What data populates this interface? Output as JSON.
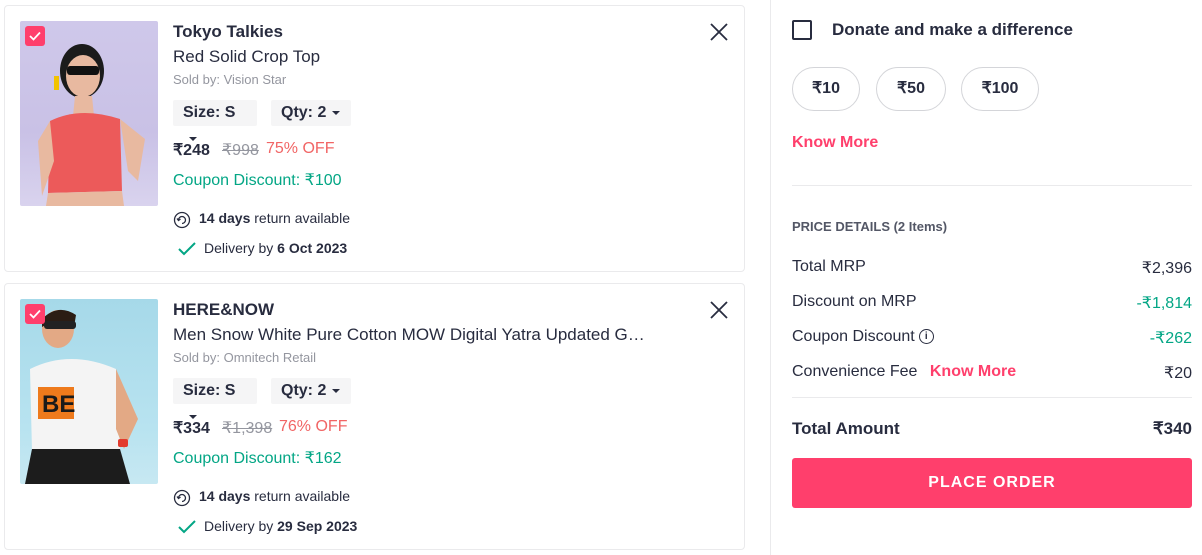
{
  "cart_items": [
    {
      "brand": "Tokyo Talkies",
      "name": "Red Solid Crop Top",
      "seller": "Sold by: Vision Star",
      "size_label": "Size: S",
      "qty_label": "Qty: 2",
      "price": "₹248",
      "mrp": "₹998",
      "discount": "75% OFF",
      "coupon": "Coupon Discount: ₹100",
      "return_days": "14 days",
      "return_text": " return available",
      "delivery_prefix": "Delivery by ",
      "delivery_date": "6 Oct 2023",
      "selected": true
    },
    {
      "brand": "HERE&NOW",
      "name": "Men Snow White Pure Cotton MOW Digital Yatra Updated G…",
      "seller": "Sold by: Omnitech Retail",
      "size_label": "Size: S",
      "qty_label": "Qty: 2",
      "price": "₹334",
      "mrp": "₹1,398",
      "discount": "76% OFF",
      "coupon": "Coupon Discount: ₹162",
      "return_days": "14 days",
      "return_text": " return available",
      "delivery_prefix": "Delivery by ",
      "delivery_date": "29 Sep 2023",
      "selected": true
    }
  ],
  "donation": {
    "label": "Donate and make a difference",
    "checked": false,
    "amounts": [
      "₹10",
      "₹50",
      "₹100"
    ],
    "know_more": "Know More"
  },
  "price_details": {
    "title": "PRICE DETAILS (2 Items)",
    "rows": [
      {
        "label": "Total MRP",
        "value": "₹2,396"
      },
      {
        "label": "Discount on MRP",
        "value": "-₹1,814"
      },
      {
        "label": "Coupon Discount",
        "value": "-₹262"
      },
      {
        "label": "Convenience Fee",
        "value": "₹20",
        "link": "Know More"
      }
    ],
    "total_label": "Total Amount",
    "total_value": "₹340",
    "place_order": "PLACE ORDER"
  },
  "colors": {
    "accent": "#ff3f6c",
    "green": "#03a685",
    "discount_red": "#f16565"
  }
}
